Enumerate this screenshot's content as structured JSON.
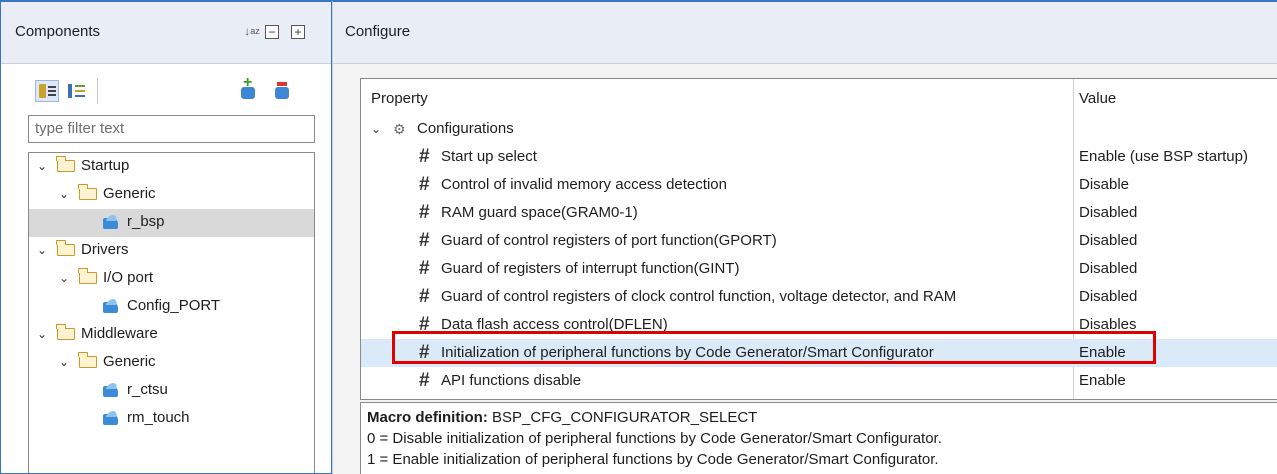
{
  "left_panel": {
    "title": "Components",
    "filter_placeholder": "type filter text",
    "tree": [
      {
        "label": "Startup",
        "type": "folder",
        "depth": 0,
        "expanded": true
      },
      {
        "label": "Generic",
        "type": "folder",
        "depth": 1,
        "expanded": true
      },
      {
        "label": "r_bsp",
        "type": "component",
        "depth": 2,
        "selected": true
      },
      {
        "label": "Drivers",
        "type": "folder",
        "depth": 0,
        "expanded": true
      },
      {
        "label": "I/O port",
        "type": "folder",
        "depth": 1,
        "expanded": true
      },
      {
        "label": "Config_PORT",
        "type": "component",
        "depth": 2
      },
      {
        "label": "Middleware",
        "type": "folder",
        "depth": 0,
        "expanded": true
      },
      {
        "label": "Generic",
        "type": "folder",
        "depth": 1,
        "expanded": true
      },
      {
        "label": "r_ctsu",
        "type": "component",
        "depth": 2
      },
      {
        "label": "rm_touch",
        "type": "component",
        "depth": 2
      }
    ]
  },
  "right_panel": {
    "title": "Configure",
    "columns": {
      "property": "Property",
      "value": "Value"
    },
    "group_label": "Configurations",
    "rows": [
      {
        "property": "Start up select",
        "value": "Enable (use BSP startup)"
      },
      {
        "property": "Control of invalid memory access detection",
        "value": "Disable"
      },
      {
        "property": "RAM guard space(GRAM0-1)",
        "value": "Disabled"
      },
      {
        "property": "Guard of control registers of port function(GPORT)",
        "value": "Disabled"
      },
      {
        "property": "Guard of registers of interrupt function(GINT)",
        "value": "Disabled"
      },
      {
        "property": "Guard of control registers of clock control function, voltage detector, and RAM",
        "value": "Disabled"
      },
      {
        "property": "Data flash access control(DFLEN)",
        "value": "Disables"
      },
      {
        "property": "Initialization of peripheral functions by Code Generator/Smart Configurator",
        "value": "Enable",
        "highlighted": true
      },
      {
        "property": "API functions disable",
        "value": "Enable"
      }
    ],
    "macro": {
      "label": "Macro definition:",
      "name": "BSP_CFG_CONFIGURATOR_SELECT",
      "line0": "0 = Disable initialization of peripheral functions by Code Generator/Smart Configurator.",
      "line1": "1 = Enable initialization of peripheral functions by Code Generator/Smart Configurator."
    }
  },
  "icons": {
    "sort": "sort-az-icon",
    "collapse": "collapse-all-icon",
    "expand": "expand-all-icon",
    "add": "add-component-icon",
    "remove": "remove-component-icon",
    "gear": "gear-icon",
    "hash": "hash-icon"
  },
  "colors": {
    "accent_border": "#3c74c4",
    "highlight_row": "#dbeaf8",
    "callout": "#e00000",
    "selected_row": "#d9d9d9"
  }
}
